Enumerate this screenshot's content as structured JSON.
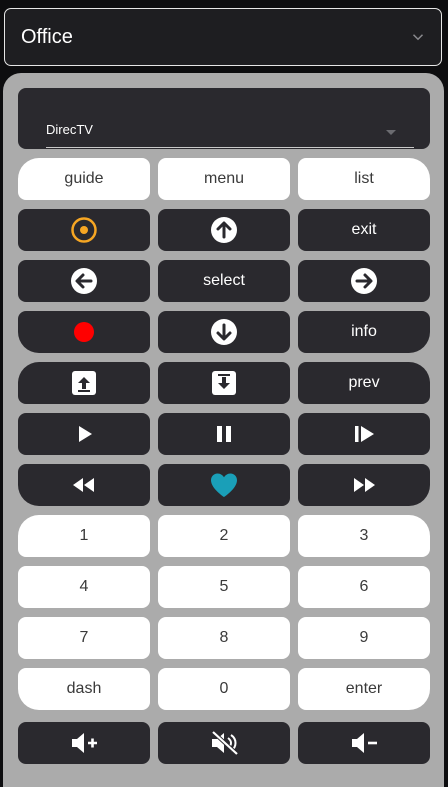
{
  "room": {
    "selected": "Office"
  },
  "source": {
    "selected": "DirecTV"
  },
  "row_nav": {
    "guide": "guide",
    "menu": "menu",
    "list": "list"
  },
  "labels": {
    "exit": "exit",
    "select": "select",
    "info": "info",
    "prev": "prev",
    "dash": "dash",
    "enter": "enter"
  },
  "numbers": [
    "1",
    "2",
    "3",
    "4",
    "5",
    "6",
    "7",
    "8",
    "9",
    "0"
  ],
  "icons": {
    "record_ring": "target-icon",
    "up": "arrow-up-circle-icon",
    "left": "arrow-left-circle-icon",
    "right": "arrow-right-circle-icon",
    "down": "arrow-down-circle-icon",
    "record": "record-dot-icon",
    "page_up": "page-up-icon",
    "page_down": "page-down-icon",
    "play": "play-icon",
    "pause": "pause-icon",
    "step": "step-forward-icon",
    "rewind": "rewind-icon",
    "favorite": "heart-icon",
    "fast_forward": "fast-forward-icon",
    "volume_up": "volume-up-icon",
    "mute": "mute-icon",
    "volume_down": "volume-down-icon"
  },
  "colors": {
    "page_bg": "#0d0d0f",
    "panel_bg": "#ababab",
    "dark_button": "#2a292e",
    "light_button": "#ffffff",
    "accent_orange": "#f6a623",
    "record_red": "#ff0000",
    "heart_teal": "#1a9fb8"
  }
}
